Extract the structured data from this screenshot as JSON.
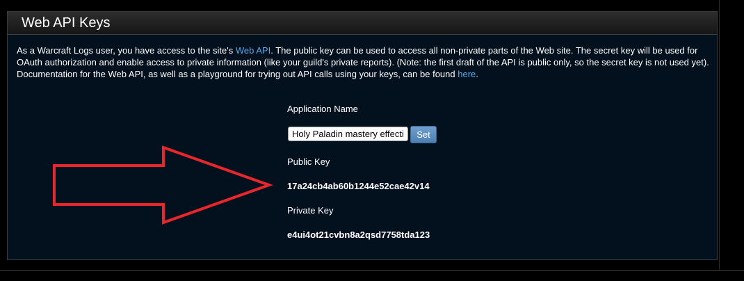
{
  "panel": {
    "title": "Web API Keys"
  },
  "description": {
    "part1": "As a Warcraft Logs user, you have access to the site's ",
    "link1": "Web API",
    "part2": ". The public key can be used to access all non-private parts of the Web site. The secret key will be used for OAuth authorization and enable access to private information (like your guild's private reports). (Note: the first draft of the API is public only, so the secret key is not used yet). Documentation for the Web API, as well as a playground for trying out API calls using your keys, can be found ",
    "link2": "here",
    "part3": "."
  },
  "form": {
    "app_name_label": "Application Name",
    "app_name_value": "Holy Paladin mastery effectiveness",
    "set_label": "Set",
    "public_key_label": "Public Key",
    "public_key_value": "17a24cb4ab60b1244e52cae42v14",
    "private_key_label": "Private Key",
    "private_key_value": "e4ui4ot21cvbn8a2qsd7758tda123"
  },
  "colors": {
    "panel_bg": "#03101d",
    "link": "#5aa9ea",
    "arrow": "#e8262c",
    "button": "#5a8cbf"
  },
  "annotations": {
    "arrow_icon": "right-arrow-icon"
  }
}
